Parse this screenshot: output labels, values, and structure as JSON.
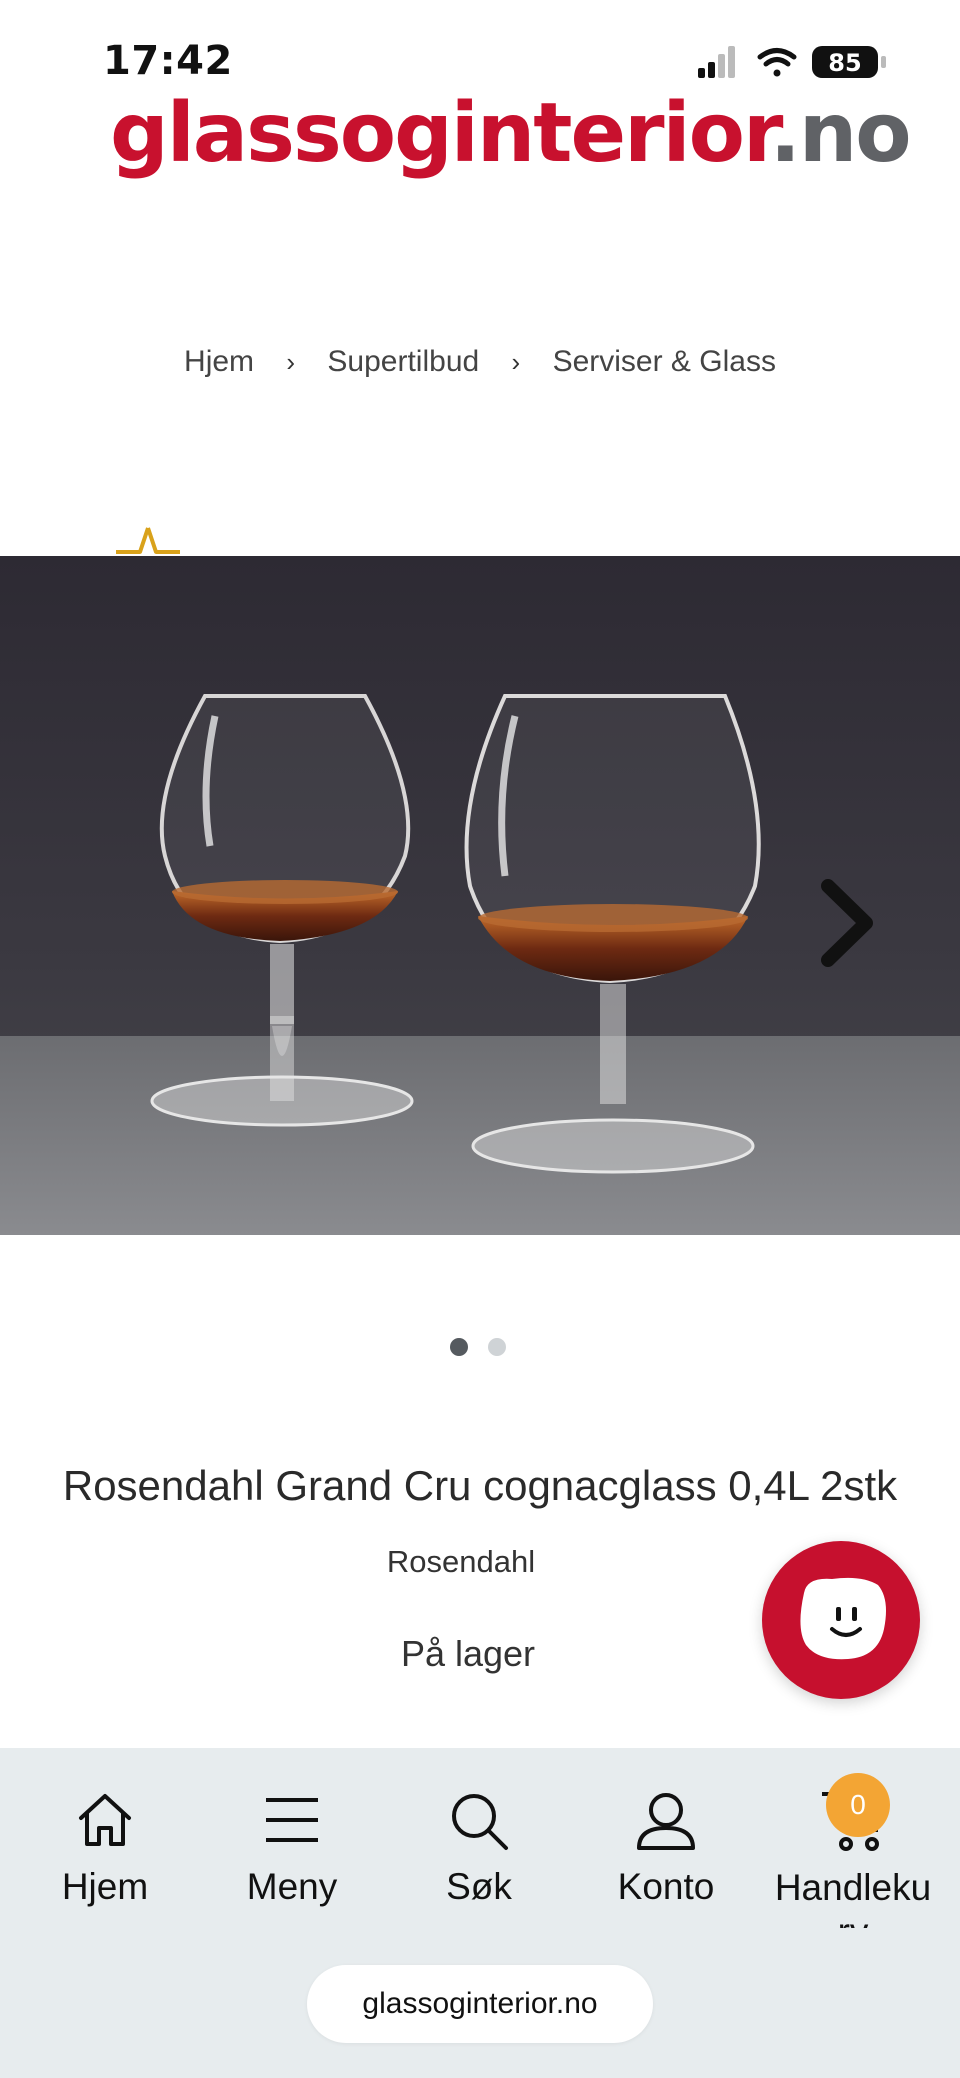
{
  "status_bar": {
    "time": "17:42",
    "battery": "85"
  },
  "logo": {
    "brand": "glassoginterior",
    "tld": ".no"
  },
  "breadcrumb": [
    "Hjem",
    "Supertilbud",
    "Serviser & Glass"
  ],
  "gallery": {
    "image_count": 2,
    "active_index": 0
  },
  "product": {
    "title": "Rosendahl Grand Cru cognacglass 0,4L 2stk",
    "brand": "Rosendahl",
    "stock": "På lager"
  },
  "bottom_nav": {
    "items": [
      {
        "label": "Hjem",
        "icon": "home-icon"
      },
      {
        "label": "Meny",
        "icon": "menu-icon"
      },
      {
        "label": "Søk",
        "icon": "search-icon"
      },
      {
        "label": "Konto",
        "icon": "user-icon"
      },
      {
        "label": "Handlekurv",
        "icon": "cart-icon"
      }
    ],
    "cart_label_line1": "Handleku",
    "cart_label_line2": "rv",
    "cart_count": "0"
  },
  "browser": {
    "url": "glassoginterior.no"
  },
  "colors": {
    "brand_red": "#c8112e",
    "badge_orange": "#f3a534",
    "nav_bg": "#e7ecee"
  }
}
